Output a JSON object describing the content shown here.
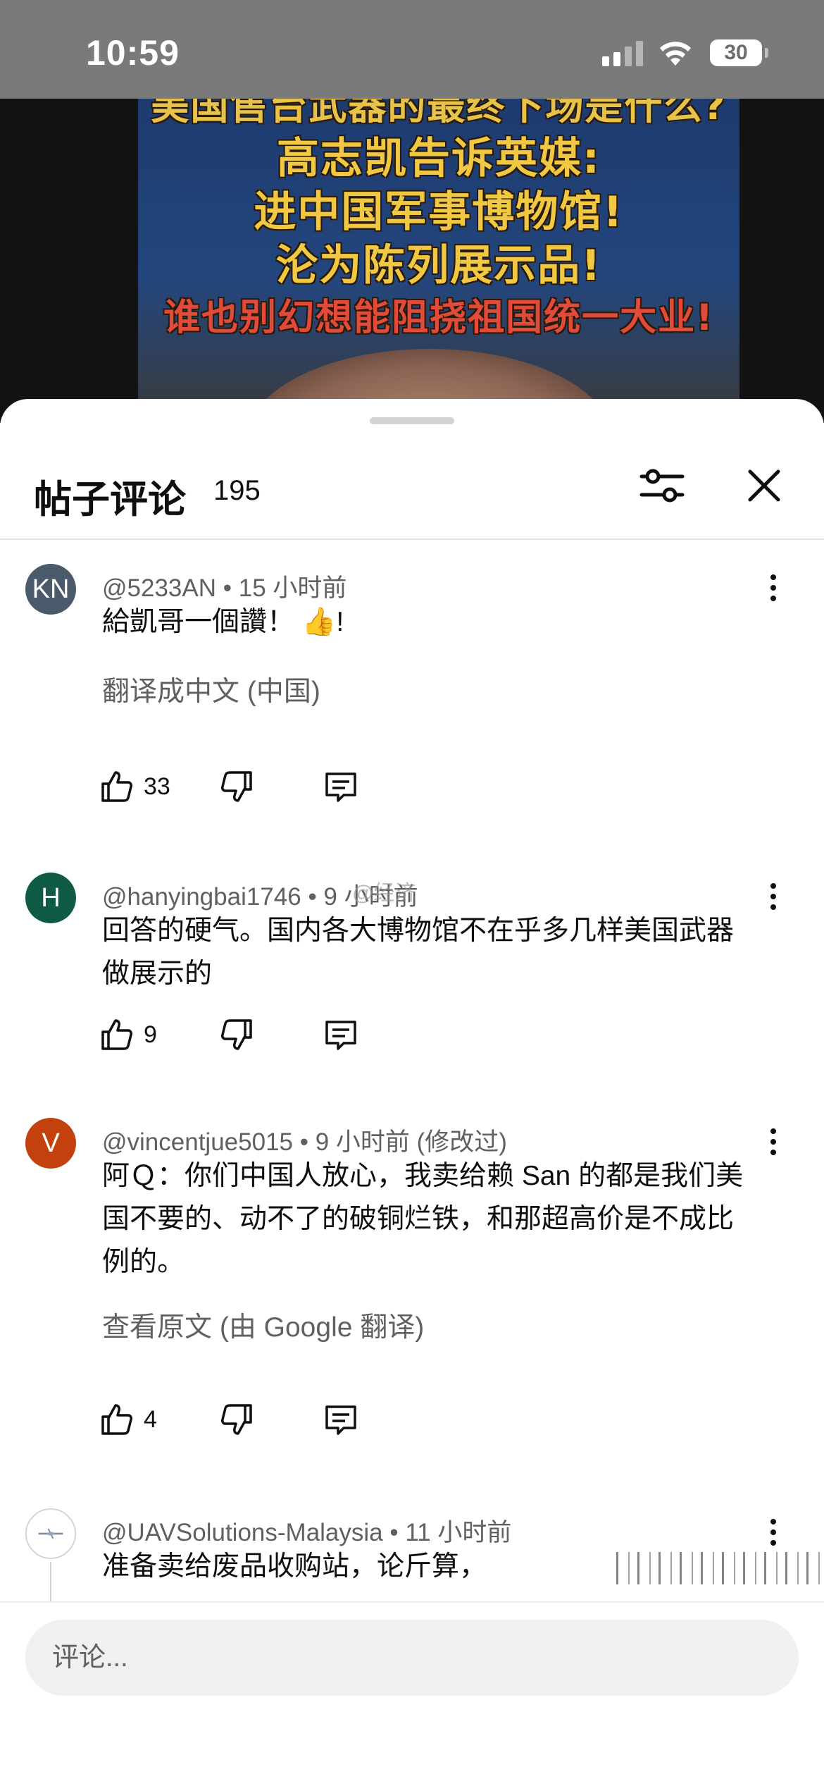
{
  "status_bar": {
    "time": "10:59",
    "battery": "30"
  },
  "video": {
    "captions": [
      "美国售台武器的最终下场是什么?",
      "高志凯告诉英媒:",
      "进中国军事博物馆!",
      "沦为陈列展示品!",
      "谁也别幻想能阻挠祖国统一大业!"
    ]
  },
  "sheet": {
    "title": "帖子评论",
    "count": "195",
    "filter_icon": "sliders-icon",
    "close_icon": "close-icon"
  },
  "comments": [
    {
      "avatar_text": "KN",
      "avatar_color": "#4a5a6a",
      "handle": "@5233AN",
      "time": "15 小时前",
      "body": "給凱哥一個讚！",
      "emoji": "👍",
      "body_suffix": "!",
      "translate": "翻译成中文 (中国)",
      "likes": "33"
    },
    {
      "avatar_text": "H",
      "avatar_color": "#0f5b45",
      "handle": "@hanyingbai1746",
      "time": "9 小时前",
      "body": "回答的硬气。国内各大博物馆不在乎多几样美国武器做展示的",
      "likes": "9"
    },
    {
      "avatar_text": "V",
      "avatar_color": "#c2410c",
      "handle": "@vincentjue5015",
      "time": "9 小时前 (修改过)",
      "body": "阿Ｑ：你们中国人放心，我卖给赖 San 的都是我们美国不要的、动不了的破铜烂铁，和那超高价是不成比例的。",
      "translate": "查看原文 (由 Google 翻译)",
      "likes": "4"
    },
    {
      "avatar_text": "",
      "avatar_color": "#ffffff",
      "handle": "@UAVSolutions-Malaysia",
      "time": "11 小时前",
      "body": "准备卖给废品收购站，论斤算，"
    }
  ],
  "watermark": "@经济",
  "input": {
    "placeholder": "评论..."
  }
}
